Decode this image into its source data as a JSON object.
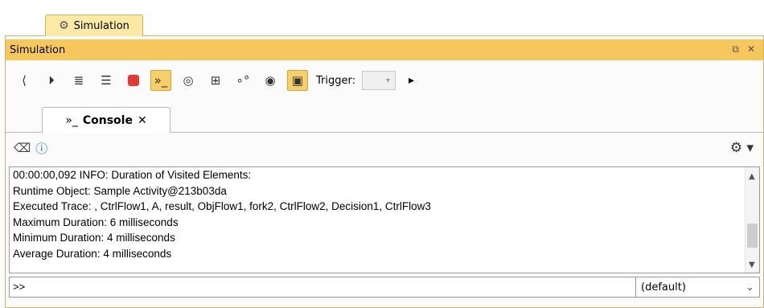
{
  "outer_tab": {
    "label": "Simulation",
    "icon": "simulation-icon"
  },
  "panel": {
    "title": "Simulation",
    "restore_icon": "restore-icon",
    "close_icon": "close-icon"
  },
  "toolbar": {
    "trigger_label": "Trigger:",
    "buttons": [
      "collapse-left-icon",
      "step-into-icon",
      "step-over-icon",
      "step-out-icon",
      "terminate-icon",
      "console-icon",
      "animation-icon",
      "tree-icon",
      "diagram-icon",
      "breakpoint-icon",
      "export-icon",
      "trigger-icon"
    ]
  },
  "console_tab": {
    "label": "Console",
    "close": "✕"
  },
  "console_toolbar": {
    "clear_icon": "eraser-icon",
    "info_icon": "info-icon",
    "settings_icon": "gear-icon"
  },
  "log": {
    "lines": [
      "00:00:00,092 INFO: Duration of Visited Elements:",
      "Runtime Object: Sample Activity@213b03da",
      "Executed Trace: , CtrlFlow1, A, result, ObjFlow1, fork2, CtrlFlow2, Decision1, CtrlFlow3",
      "Maximum Duration: 6 milliseconds",
      "Minimum Duration: 4 milliseconds",
      "Average Duration: 4 milliseconds"
    ]
  },
  "input": {
    "value": ">>",
    "mode": "(default)"
  }
}
